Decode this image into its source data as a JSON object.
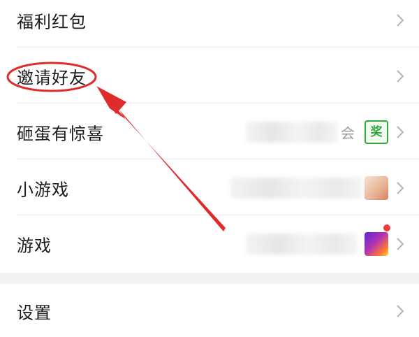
{
  "menu": {
    "items": [
      {
        "label": "福利红包"
      },
      {
        "label": "邀请好友"
      },
      {
        "label": "砸蛋有惊喜",
        "hint": "会",
        "badge": "奖"
      },
      {
        "label": "小游戏"
      },
      {
        "label": "游戏"
      }
    ],
    "settings": {
      "label": "设置"
    }
  },
  "colors": {
    "annotation": "#e02b2b",
    "prize_badge": "#2faa3a",
    "divider": "#ececec",
    "section_gap": "#f2f2f2"
  },
  "icons": {
    "chevron": "chevron-right-icon",
    "prize": "prize-badge-icon",
    "minigame": "minigame-thumbnail",
    "game": "game-thumbnail",
    "notification": "red-dot-icon"
  }
}
